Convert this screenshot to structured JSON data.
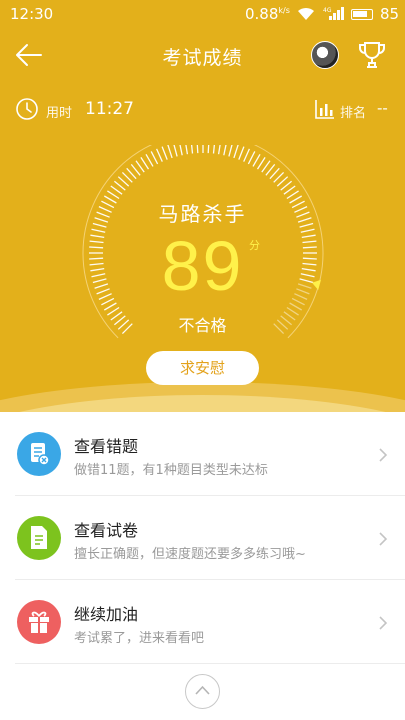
{
  "status_bar": {
    "time": "12:30",
    "net_speed": "0.88",
    "net_speed_unit": "k/s",
    "signal_label": "4G",
    "battery": "85"
  },
  "header": {
    "title": "考试成绩"
  },
  "stats": {
    "time_label": "用时",
    "time_value": "11:27",
    "rank_label": "排名",
    "rank_value": "--"
  },
  "score_panel": {
    "title": "马路杀手",
    "score": "89",
    "unit": "分",
    "result": "不合格",
    "score_fraction": 0.89,
    "button_label": "求安慰"
  },
  "menu": {
    "items": [
      {
        "title": "查看错题",
        "subtitle": "做错11题，有1种题目类型未达标",
        "icon": "wrong-questions-icon",
        "color": "#3aa7e6"
      },
      {
        "title": "查看试卷",
        "subtitle": "擅长正确题，但速度题还要多多练习哦~",
        "icon": "exam-paper-icon",
        "color": "#7dc31e"
      },
      {
        "title": "继续加油",
        "subtitle": "考试累了，进来看看吧",
        "icon": "gift-icon",
        "color": "#ee6060"
      }
    ]
  },
  "colors": {
    "header_bg": "#e3b01b",
    "score": "#fff14a",
    "accent_button_text": "#e3a21b"
  }
}
